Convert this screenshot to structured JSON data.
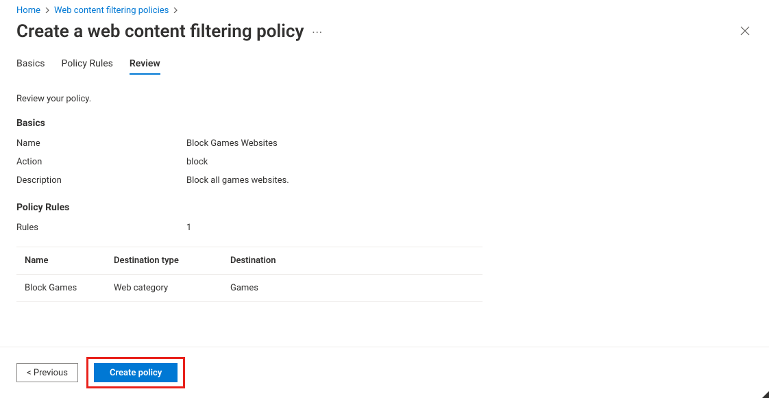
{
  "breadcrumb": {
    "items": [
      {
        "label": "Home"
      },
      {
        "label": "Web content filtering policies"
      }
    ]
  },
  "page": {
    "title": "Create a web content filtering policy"
  },
  "tabs": [
    {
      "label": "Basics",
      "active": false
    },
    {
      "label": "Policy Rules",
      "active": false
    },
    {
      "label": "Review",
      "active": true
    }
  ],
  "intro": "Review your policy.",
  "sections": {
    "basics": {
      "heading": "Basics",
      "rows": {
        "name": {
          "label": "Name",
          "value": "Block Games Websites"
        },
        "action": {
          "label": "Action",
          "value": "block"
        },
        "description": {
          "label": "Description",
          "value": "Block all games websites."
        }
      }
    },
    "policyRules": {
      "heading": "Policy Rules",
      "rulesLabel": "Rules",
      "rulesCount": "1",
      "table": {
        "headers": {
          "name": "Name",
          "destType": "Destination type",
          "destination": "Destination"
        },
        "rows": [
          {
            "name": "Block Games",
            "destType": "Web category",
            "destination": "Games"
          }
        ]
      }
    }
  },
  "footer": {
    "previous": "<  Previous",
    "create": "Create policy"
  }
}
